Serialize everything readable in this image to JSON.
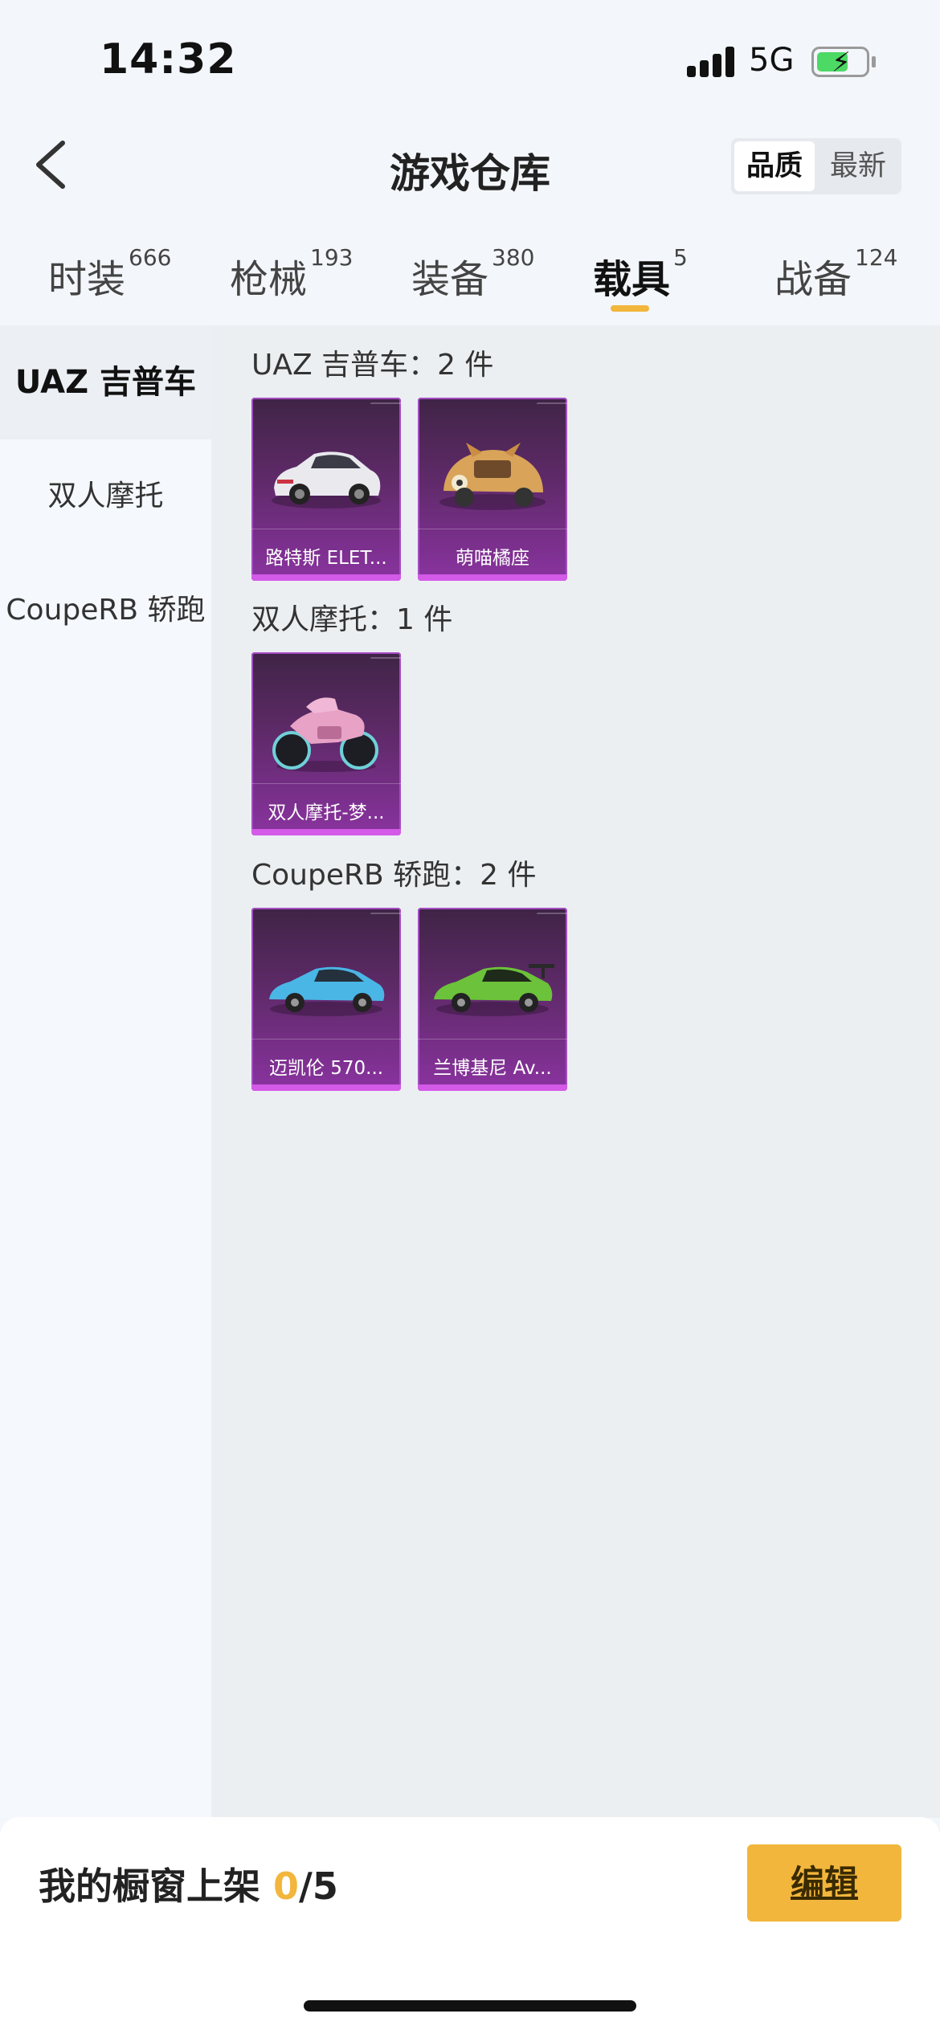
{
  "status_bar": {
    "time": "14:32",
    "network": "5G",
    "battery_level": 0.58
  },
  "header": {
    "title": "游戏仓库",
    "sort_options": [
      "品质",
      "最新"
    ],
    "sort_selected": "品质"
  },
  "tabs": [
    {
      "label": "时装",
      "count": "666"
    },
    {
      "label": "枪械",
      "count": "193"
    },
    {
      "label": "装备",
      "count": "380"
    },
    {
      "label": "载具",
      "count": "5",
      "active": true
    },
    {
      "label": "战备",
      "count": "124"
    }
  ],
  "sidebar": {
    "items": [
      {
        "label": "UAZ 吉普车",
        "active": true
      },
      {
        "label": "双人摩托"
      },
      {
        "label": "CoupeRB 轿跑"
      }
    ]
  },
  "groups": [
    {
      "title": "UAZ 吉普车：2 件",
      "items": [
        {
          "name": "路特斯 ELET...",
          "icon": "suv-car-icon"
        },
        {
          "name": "萌喵橘座",
          "icon": "cat-beetle-car-icon"
        }
      ]
    },
    {
      "title": "双人摩托：1 件",
      "items": [
        {
          "name": "双人摩托-梦...",
          "icon": "motorcycle-icon"
        }
      ]
    },
    {
      "title": "CoupeRB 轿跑：2 件",
      "items": [
        {
          "name": "迈凯伦 570...",
          "icon": "blue-sports-car-icon"
        },
        {
          "name": "兰博基尼 Av...",
          "icon": "green-sports-car-icon"
        }
      ]
    }
  ],
  "footer": {
    "showcase_label": "我的橱窗上架",
    "showcase_count": "0",
    "showcase_total": "/5",
    "edit_label": "编辑"
  },
  "colors": {
    "accent": "#f2b63c",
    "card_purple": "#8a33a0"
  }
}
